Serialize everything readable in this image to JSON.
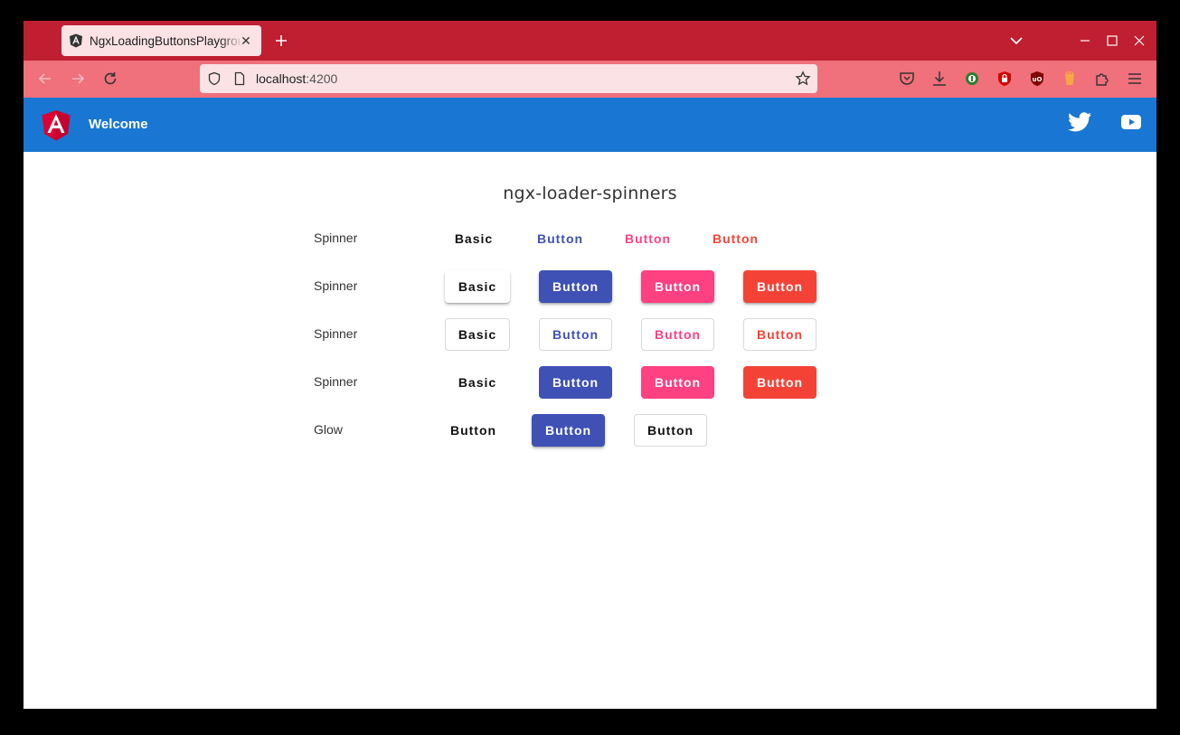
{
  "browser": {
    "tab_title": "NgxLoadingButtonsPlayground",
    "url_host": "localhost",
    "url_port": ":4200"
  },
  "header": {
    "title": "Welcome"
  },
  "page": {
    "title": "ngx-loader-spinners"
  },
  "colors": {
    "primary": "#3f51b5",
    "accent": "#ff4081",
    "warn": "#f44336",
    "header": "#1976d2",
    "browser_tabstrip": "#c01f31",
    "browser_toolbar": "#f0707b"
  },
  "rows": [
    {
      "label": "Spinner",
      "variant": "basic-text",
      "buttons": [
        "Basic",
        "Button",
        "Button",
        "Button"
      ]
    },
    {
      "label": "Spinner",
      "variant": "raised",
      "buttons": [
        "Basic",
        "Button",
        "Button",
        "Button"
      ]
    },
    {
      "label": "Spinner",
      "variant": "stroked",
      "buttons": [
        "Basic",
        "Button",
        "Button",
        "Button"
      ]
    },
    {
      "label": "Spinner",
      "variant": "flat",
      "buttons": [
        "Basic",
        "Button",
        "Button",
        "Button"
      ]
    },
    {
      "label": "Glow",
      "variant": "glow",
      "buttons": [
        "Button",
        "Button",
        "Button"
      ]
    }
  ]
}
